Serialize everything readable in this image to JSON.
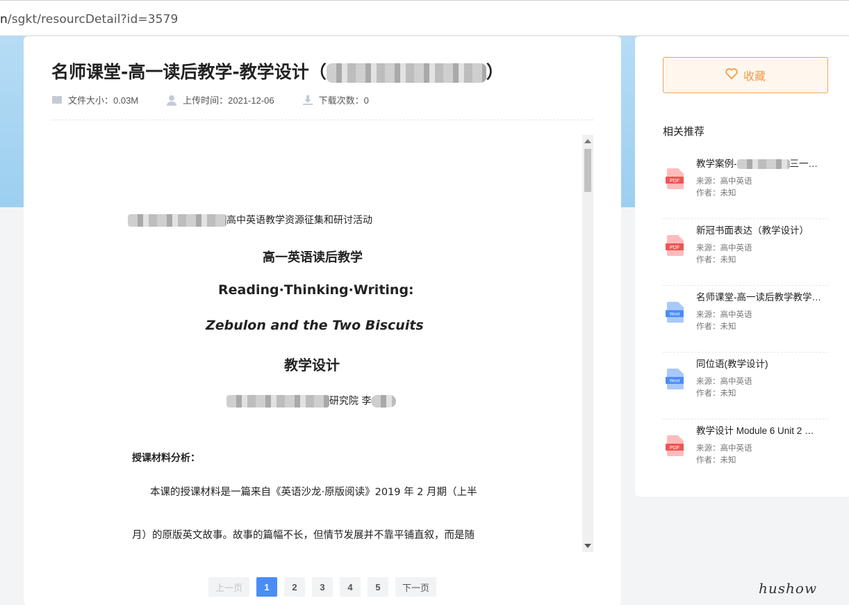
{
  "browser": {
    "url_prefix": "n",
    "url_path": "/sgkt/resourcDetail?id=3579"
  },
  "resource": {
    "title": "名师课堂-高一读后教学-教学设计（",
    "title_end": "）",
    "file_size_label": "文件大小：0.03M",
    "upload_time_label": "上传时间：2021-12-06",
    "download_count_label": "下载次数：0"
  },
  "document": {
    "header_line": "高中英语教学资源征集和研讨活动",
    "heading1": "高一英语读后教学",
    "heading2": "Reading·Thinking·Writing:",
    "heading3": "Zebulon and the Two Biscuits",
    "heading4": "教学设计",
    "author_line_tail": "研究院 李",
    "section_title": "授课材料分析：",
    "para1": "本课的授课材料是一篇来自《英语沙龙·原版阅读》2019 年 2 月期（上半",
    "para2": "月）的原版英文故事。故事的篇幅不长，但情节发展并不靠平铺直叙，而是随"
  },
  "pagination": {
    "prev": "上一页",
    "pages": [
      "1",
      "2",
      "3",
      "4",
      "5"
    ],
    "next": "下一页",
    "current": "1"
  },
  "sidebar": {
    "favorite_label": "收藏",
    "related_title": "相关推荐",
    "items": [
      {
        "title_a": "教学案例-",
        "title_b": "三一…",
        "type": "PDF",
        "source": "来源：高中英语",
        "author": "作者：未知"
      },
      {
        "title": "新冠书面表达（教学设计）",
        "type": "PDF",
        "source": "来源：高中英语",
        "author": "作者：未知"
      },
      {
        "title": "名师课堂-高一读后教学教学…",
        "type": "Word",
        "source": "来源：高中英语",
        "author": "作者：未知"
      },
      {
        "title": "同位语(教学设计)",
        "type": "Word",
        "source": "来源：高中英语",
        "author": "作者：未知"
      },
      {
        "title": "教学设计 Module 6 Unit 2 …",
        "type": "PDF",
        "source": "来源：高中英语",
        "author": "作者：未知"
      }
    ]
  },
  "watermark": "hushow",
  "colors": {
    "accent": "#4a8df8",
    "favorite": "#f09a45",
    "pdf": "#f05454",
    "word": "#4a8df8"
  },
  "icons": {
    "file_size": "book-icon",
    "upload": "user-icon",
    "download": "download-icon",
    "favorite": "heart-icon"
  }
}
